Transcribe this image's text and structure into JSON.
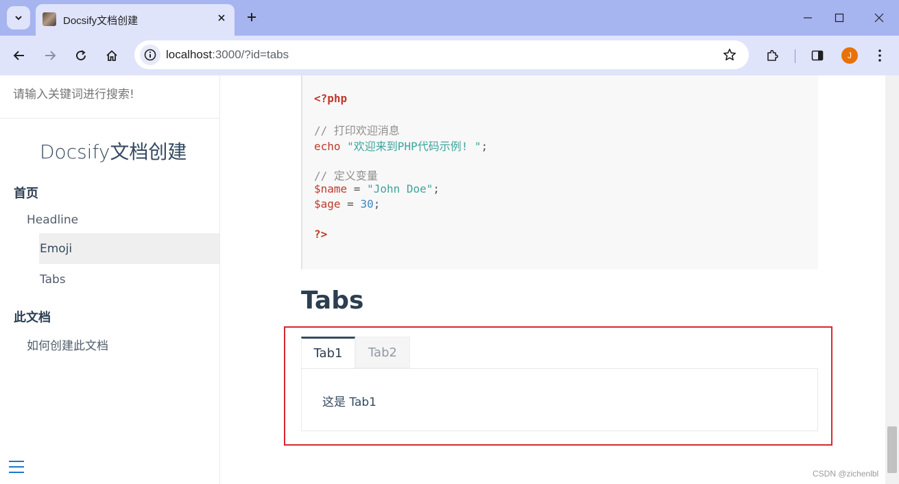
{
  "browser": {
    "tab_title": "Docsify文档创建",
    "url_host": "localhost",
    "url_rest": ":3000/?id=tabs",
    "avatar_letter": "J",
    "accent_color": "#a6b4ef"
  },
  "sidebar": {
    "search_placeholder": "请输入关键词进行搜索!",
    "app_name": "Docsify文档创建",
    "sections": [
      {
        "label": "首页"
      },
      {
        "label": "此文档"
      }
    ],
    "links": [
      {
        "label": "Headline"
      },
      {
        "label": "Emoji"
      },
      {
        "label": "Tabs"
      },
      {
        "label": "如何创建此文档"
      }
    ]
  },
  "code": {
    "open_tag": "<?php",
    "comment1": "// 打印欢迎消息",
    "echo_kw": "echo",
    "echo_str": "\"欢迎来到PHP代码示例! \"",
    "semi": ";",
    "comment2": "// 定义变量",
    "var_name": "$name",
    "eq": " = ",
    "name_str": "\"John Doe\"",
    "var_age": "$age",
    "age_num": "30",
    "close_tag": "?>"
  },
  "content": {
    "heading": "Tabs",
    "tabs": [
      {
        "label": "Tab1"
      },
      {
        "label": "Tab2"
      }
    ],
    "panel_text": "这是 Tab1"
  },
  "watermark": "CSDN @zichenlbl"
}
